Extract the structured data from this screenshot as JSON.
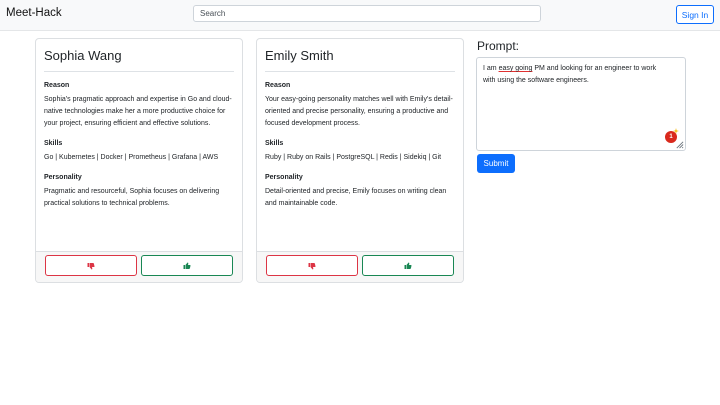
{
  "app": {
    "title": "Meet-Hack"
  },
  "search": {
    "placeholder": "Search",
    "value": ""
  },
  "header": {
    "signin_label": "Sign In"
  },
  "labels": {
    "reason": "Reason",
    "skills": "Skills",
    "personality": "Personality"
  },
  "candidates": [
    {
      "name": "Sophia Wang",
      "reason": "Sophia's pragmatic approach and expertise in Go and cloud-native technologies make her a more productive choice for your project, ensuring efficient and effective solutions.",
      "skills": "Go | Kubernetes | Docker | Prometheus | Grafana | AWS",
      "personality": "Pragmatic and resourceful, Sophia focuses on delivering practical solutions to technical problems."
    },
    {
      "name": "Emily Smith",
      "reason": "Your easy-going personality matches well with Emily's detail-oriented and precise personality, ensuring a productive and focused development process.",
      "skills": "Ruby | Ruby on Rails | PostgreSQL | Redis | Sidekiq | Git",
      "personality": "Detail-oriented and precise, Emily focuses on writing clean and maintainable code."
    }
  ],
  "prompt": {
    "label": "Prompt:",
    "text_part1": "I am ",
    "text_flagged": "easy going",
    "text_part2": " PM and looking for an engineer to work with using the software engineers.",
    "badge_count": "1",
    "submit_label": "Submit"
  },
  "icons": {
    "thumbs_down": "thumbs-down-icon",
    "thumbs_up": "thumbs-up-icon",
    "grammar": "grammar-assistant-icon",
    "resize": "resize-grip-icon"
  },
  "colors": {
    "primary": "#0d6efd",
    "danger": "#dc3545",
    "success": "#198754",
    "navbar_bg": "#f8f9fa"
  }
}
